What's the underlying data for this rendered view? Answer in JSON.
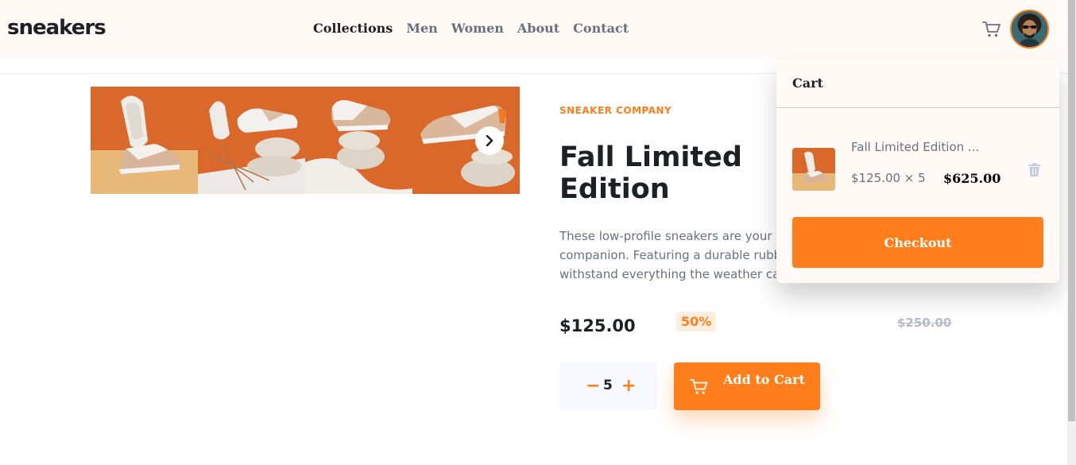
{
  "brand": {
    "logo": "sneakers"
  },
  "nav": {
    "items": [
      {
        "label": "Collections",
        "active": true
      },
      {
        "label": "Men"
      },
      {
        "label": "Women"
      },
      {
        "label": "About"
      },
      {
        "label": "Contact"
      }
    ]
  },
  "header": {
    "cart_icon": "cart-icon",
    "avatar": "user-avatar"
  },
  "gallery": {
    "thumbnail_count": 4,
    "next_icon": "chevron-right-icon"
  },
  "product": {
    "company": "SNEAKER COMPANY",
    "title": "Fall Limited Edition Sneakers",
    "description": "These low-profile sneakers are your perfect casual wear companion. Featuring a durable rubber outer sole, they'll withstand everything the weather can offer.",
    "price": "$125.00",
    "discount": "50%",
    "old_price": "$250.00"
  },
  "quantity": {
    "value": "5",
    "minus": "−",
    "plus": "+"
  },
  "add_to_cart": {
    "label": "Add to Cart"
  },
  "cart": {
    "title": "Cart",
    "item_name": "Fall Limited Edition ...",
    "item_calc": "$125.00 × 5",
    "item_total": "$625.00",
    "checkout_label": "Checkout",
    "delete_icon": "trash-icon"
  },
  "colors": {
    "accent": "#ff7e1b",
    "accent_pale": "#ffede0",
    "text_dark": "#1d2025",
    "text_gray": "#69707d",
    "header_bg": "#fffaf6"
  }
}
